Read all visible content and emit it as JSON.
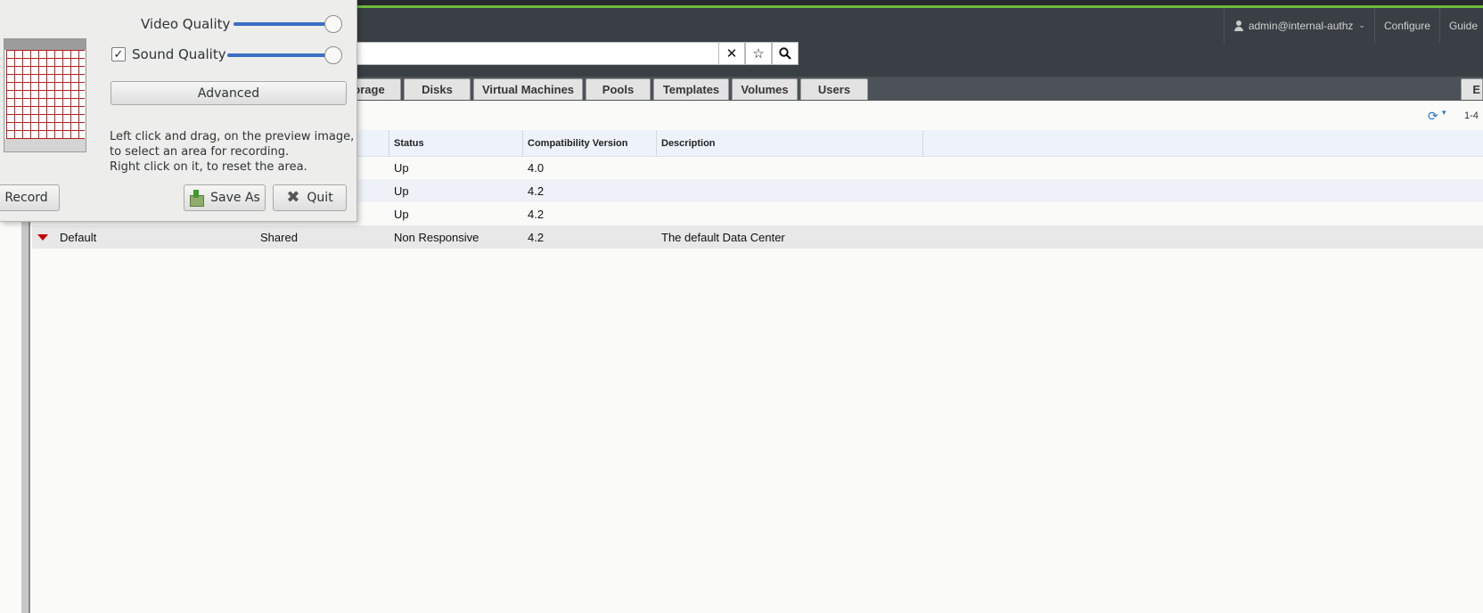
{
  "header": {
    "user": "admin@internal-authz",
    "configure": "Configure",
    "guide": "Guide"
  },
  "search": {
    "value": "",
    "clear_icon": "close-icon",
    "bookmark_icon": "star-icon",
    "search_icon": "search-icon"
  },
  "tabs": [
    {
      "label": "orage"
    },
    {
      "label": "Disks"
    },
    {
      "label": "Virtual Machines"
    },
    {
      "label": "Pools"
    },
    {
      "label": "Templates"
    },
    {
      "label": "Volumes"
    },
    {
      "label": "Users"
    },
    {
      "label": "E"
    }
  ],
  "toolbar": {
    "pager": "1-4"
  },
  "table": {
    "columns": [
      "Status",
      "Compatibility Version",
      "Description"
    ],
    "rows": [
      {
        "name": "",
        "storage_type": "",
        "status": "Up",
        "version": "4.0",
        "description": ""
      },
      {
        "name": "",
        "storage_type": "",
        "status": "Up",
        "version": "4.2",
        "description": ""
      },
      {
        "name": "",
        "storage_type": "",
        "status": "Up",
        "version": "4.2",
        "description": ""
      },
      {
        "name": "Default",
        "storage_type": "Shared",
        "status": "Non Responsive",
        "version": "4.2",
        "description": "The default Data Center"
      }
    ]
  },
  "recorder": {
    "video_quality_label": "Video Quality",
    "sound_quality_label": "Sound Quality",
    "sound_quality_checked": true,
    "video_quality_level": 1.0,
    "sound_quality_level": 1.0,
    "advanced_label": "Advanced",
    "hint_lines": [
      "Left click and drag, on the preview image,",
      "to select an area for recording.",
      "Right click on it, to reset the area."
    ],
    "record_label": "Record",
    "save_as_label": "Save As",
    "quit_label": "Quit"
  },
  "colors": {
    "header_bg": "#393f44",
    "accent_green": "#6dbb3b",
    "status_down_red": "#cc0000",
    "slider_blue": "#3b6fc4"
  }
}
